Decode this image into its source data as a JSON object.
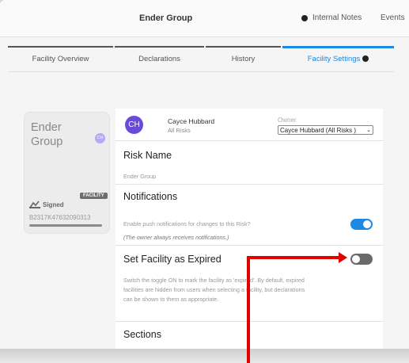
{
  "header": {
    "title": "Ender Group",
    "internal_notes": "Internal Notes",
    "events": "Events"
  },
  "tabs": [
    {
      "label": "Facility Overview",
      "active": false
    },
    {
      "label": "Declarations",
      "active": false
    },
    {
      "label": "History",
      "active": false
    },
    {
      "label": "Facility Settings",
      "active": true
    }
  ],
  "card": {
    "name": "Ender Group",
    "avatar": "CH",
    "badge": "FACILITY",
    "signed": "Signed",
    "code": "B2317K47632090313"
  },
  "owner": {
    "initials": "CH",
    "name": "Cayce Hubbard",
    "subtitle": "All Risks",
    "label": "Owner",
    "selected": "Cayce Hubbard (All Risks )"
  },
  "sections": {
    "risk_name": {
      "title": "Risk Name",
      "value": "Ender Group"
    },
    "notifications": {
      "title": "Notifications",
      "text": "Enable push notifications for changes to this Risk?",
      "note": "(The owner always receives notifications.)",
      "enabled": true
    },
    "expired": {
      "title": "Set Facility as Expired",
      "description": "Switch the toggle ON to mark the facility as 'expired'. By default, expired facilities are hidden from users when selecting a facility, but declarations can be shown to them as appropriate.",
      "enabled": false
    },
    "sections": {
      "title": "Sections"
    }
  },
  "colors": {
    "accent": "#1e88e5",
    "annotation": "#e10000",
    "avatar": "#6a4bd8"
  }
}
